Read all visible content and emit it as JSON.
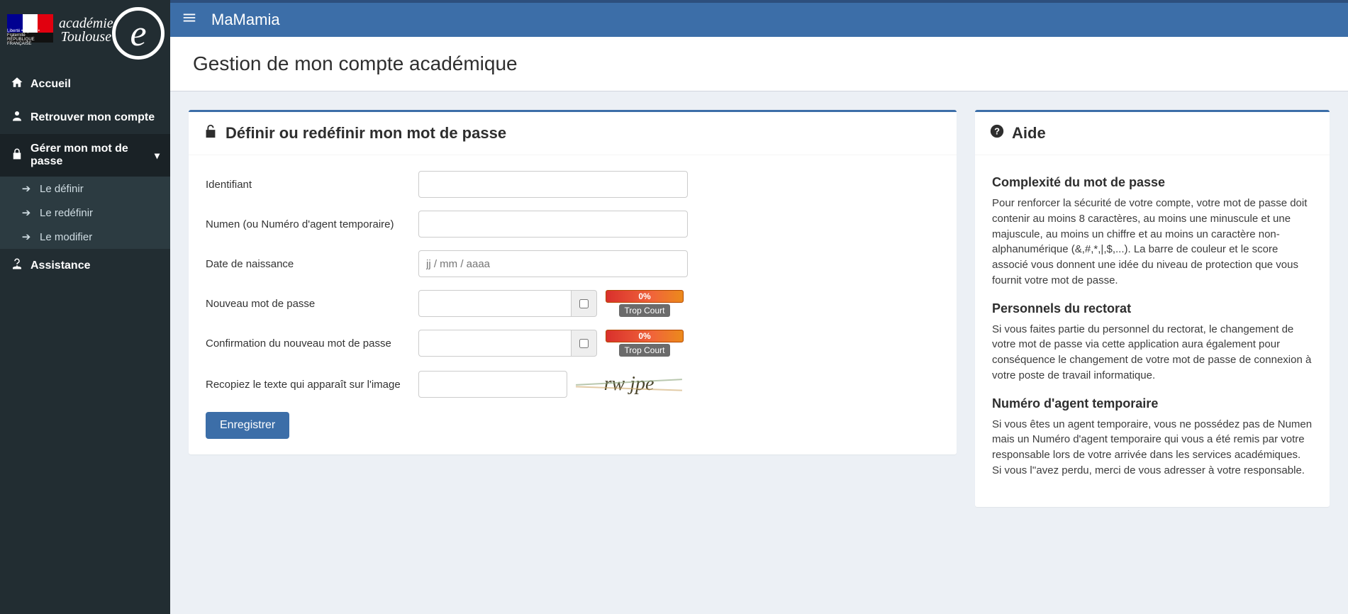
{
  "app": {
    "title": "MaMamia",
    "page_title": "Gestion de mon compte académique",
    "logo_academie": "académie",
    "logo_toulouse": "Toulouse",
    "flag_line1": "Liberté • Égalité • Fraternité",
    "flag_line2": "RÉPUBLIQUE FRANÇAISE"
  },
  "sidebar": {
    "items": [
      {
        "icon": "home-icon",
        "label": "Accueil"
      },
      {
        "icon": "user-icon",
        "label": "Retrouver mon compte"
      },
      {
        "icon": "lock-icon",
        "label": "Gérer mon mot de passe",
        "expanded": true,
        "children": [
          {
            "label": "Le définir"
          },
          {
            "label": "Le redéfinir"
          },
          {
            "label": "Le modifier"
          }
        ]
      },
      {
        "icon": "help-icon",
        "label": "Assistance"
      }
    ]
  },
  "panel": {
    "title": "Définir ou redéfinir mon mot de passe",
    "fields": {
      "identifiant": "Identifiant",
      "numen": "Numen (ou Numéro d'agent temporaire)",
      "dob": "Date de naissance",
      "dob_placeholder": "jj / mm / aaaa",
      "new_pw": "Nouveau mot de passe",
      "confirm_pw": "Confirmation du nouveau mot de passe",
      "captcha_label": "Recopiez le texte qui apparaît sur l'image",
      "captcha_text": "rw jpe"
    },
    "strength": {
      "percent": "0%",
      "label": "Trop Court"
    },
    "submit": "Enregistrer"
  },
  "aide": {
    "title": "Aide",
    "sections": [
      {
        "heading": "Complexité du mot de passe",
        "body": "Pour renforcer la sécurité de votre compte, votre mot de passe doit contenir au moins 8 caractères, au moins une minuscule et une majuscule, au moins un chiffre et au moins un caractère non-alphanumérique (&,#,*,|,$,...). La barre de couleur et le score associé vous donnent une idée du niveau de protection que vous fournit votre mot de passe."
      },
      {
        "heading": "Personnels du rectorat",
        "body": "Si vous faites partie du personnel du rectorat, le changement de votre mot de passe via cette application aura également pour conséquence le changement de votre mot de passe de connexion à votre poste de travail informatique."
      },
      {
        "heading": "Numéro d'agent temporaire",
        "body": "Si vous êtes un agent temporaire, vous ne possédez pas de Numen mais un Numéro d'agent temporaire qui vous a été remis par votre responsable lors de votre arrivée dans les services académiques. Si vous l''avez perdu, merci de vous adresser à votre responsable."
      }
    ]
  }
}
